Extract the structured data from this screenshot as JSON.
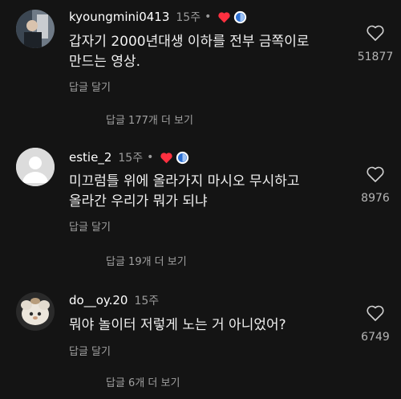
{
  "comments": [
    {
      "username": "kyoungmini0413",
      "time": "15주",
      "dot": "•",
      "text": "갑자기 2000년대생 이하를 전부 금쪽이로\n만드는 영상.",
      "reply_label": "답글 달기",
      "more_replies": "답글 177개 더 보기",
      "likes": "51877",
      "creator_liked": true
    },
    {
      "username": "estie_2",
      "time": "15주",
      "dot": "•",
      "text": "미끄럼틀 위에 올라가지 마시오 무시하고\n올라간 우리가 뭐가 되냐",
      "reply_label": "답글 달기",
      "more_replies": "답글 19개 더 보기",
      "likes": "8976",
      "creator_liked": true
    },
    {
      "username": "do__oy.20",
      "time": "15주",
      "text": "뭐야 놀이터 저렇게 노는 거 아니었어?",
      "reply_label": "답글 달기",
      "more_replies": "답글 6개 더 보기",
      "likes": "6749",
      "creator_liked": false
    }
  ],
  "colors": {
    "background": "#141414",
    "heart_red": "#ff3040",
    "muted": "#a0a0a0"
  }
}
